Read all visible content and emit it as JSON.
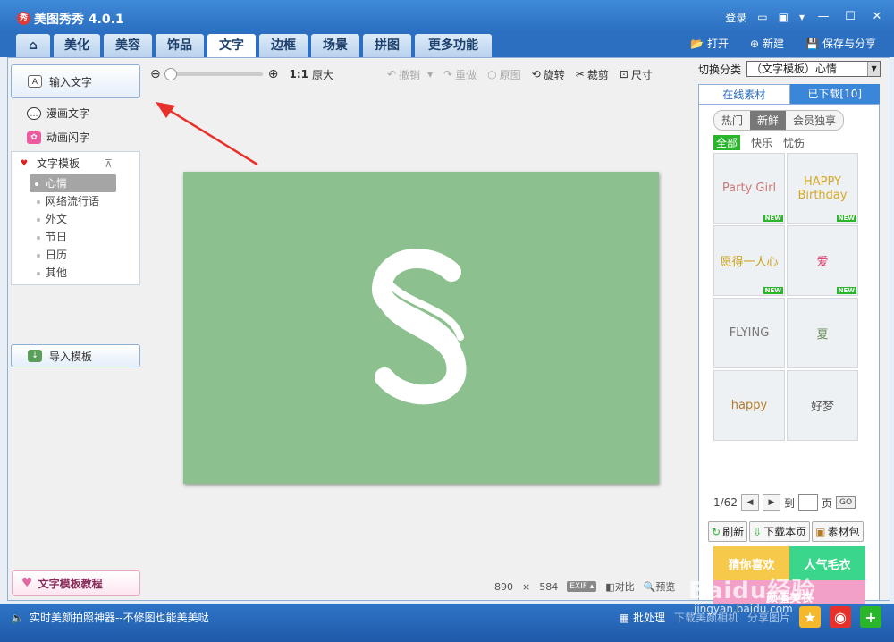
{
  "window": {
    "title": "美图秀秀 4.0.1",
    "logo_text": "秀",
    "login": "登录"
  },
  "tabs": [
    {
      "label": "美化"
    },
    {
      "label": "美容"
    },
    {
      "label": "饰品"
    },
    {
      "label": "文字"
    },
    {
      "label": "边框"
    },
    {
      "label": "场景"
    },
    {
      "label": "拼图"
    },
    {
      "label": "更多功能"
    }
  ],
  "file_actions": {
    "open": "打开",
    "new": "新建",
    "save": "保存与分享"
  },
  "left": {
    "input_text": "输入文字",
    "comic_text": "漫画文字",
    "anim_text": "动画闪字",
    "template_header": "文字模板",
    "template_items": [
      "心情",
      "网络流行语",
      "外文",
      "节日",
      "日历",
      "其他"
    ],
    "selected_item": "心情",
    "import_template": "导入模板",
    "tutorial": "文字模板教程"
  },
  "toolbar": {
    "zoom_ratio": "1:1",
    "original_size": "原大",
    "undo": "撤销",
    "redo": "重做",
    "original": "原图",
    "rotate": "旋转",
    "crop": "裁剪",
    "size": "尺寸"
  },
  "canvas": {
    "width": "890",
    "height": "584",
    "exif": "EXIF",
    "compare": "对比",
    "preview": "预览",
    "bg_color": "#8cc08f"
  },
  "right": {
    "switch_category_label": "切换分类",
    "category_value": "（文字模板）心情",
    "tab_online": "在线素材",
    "tab_downloaded": "已下载[10]",
    "subtabs": [
      "热门",
      "新鲜",
      "会员独享"
    ],
    "filters": [
      "全部",
      "快乐",
      "忧伤"
    ],
    "thumbnails": [
      {
        "text": "Party Girl",
        "is_new": true,
        "new_label": "NEW",
        "color": "#c77"
      },
      {
        "text": "HAPPY Birthday",
        "is_new": true,
        "new_label": "NEW",
        "color": "#d6a82a"
      },
      {
        "text": "愿得一人心",
        "is_new": true,
        "new_label": "NEW",
        "color": "#c9a21a"
      },
      {
        "text": "爱",
        "is_new": true,
        "new_label": "NEW",
        "color": "#e23c6e"
      },
      {
        "text": "FLYING",
        "is_new": false,
        "new_label": "",
        "color": "#777"
      },
      {
        "text": "夏",
        "is_new": false,
        "new_label": "",
        "color": "#6a8f5a"
      },
      {
        "text": "happy",
        "is_new": false,
        "new_label": "",
        "color": "#b57a2a"
      },
      {
        "text": "好梦",
        "is_new": false,
        "new_label": "",
        "color": "#555"
      }
    ],
    "page_current": "1/62",
    "page_to": "到",
    "page_unit": "页",
    "go": "GO",
    "refresh": "刷新",
    "download_page": "下载本页",
    "material_pack": "素材包",
    "banner1_left": "猜你喜欢",
    "banner1_right": "人气毛衣",
    "banner2": "颜值美衣"
  },
  "statusbar": {
    "promo": "实时美颜拍照神器--不修图也能美美哒",
    "batch": "批处理",
    "upload_hint": "下载美颜相机",
    "share_hint": "分享图片"
  },
  "watermark": {
    "main": "Baidu经验",
    "sub": "jingyan.baidu.com"
  }
}
